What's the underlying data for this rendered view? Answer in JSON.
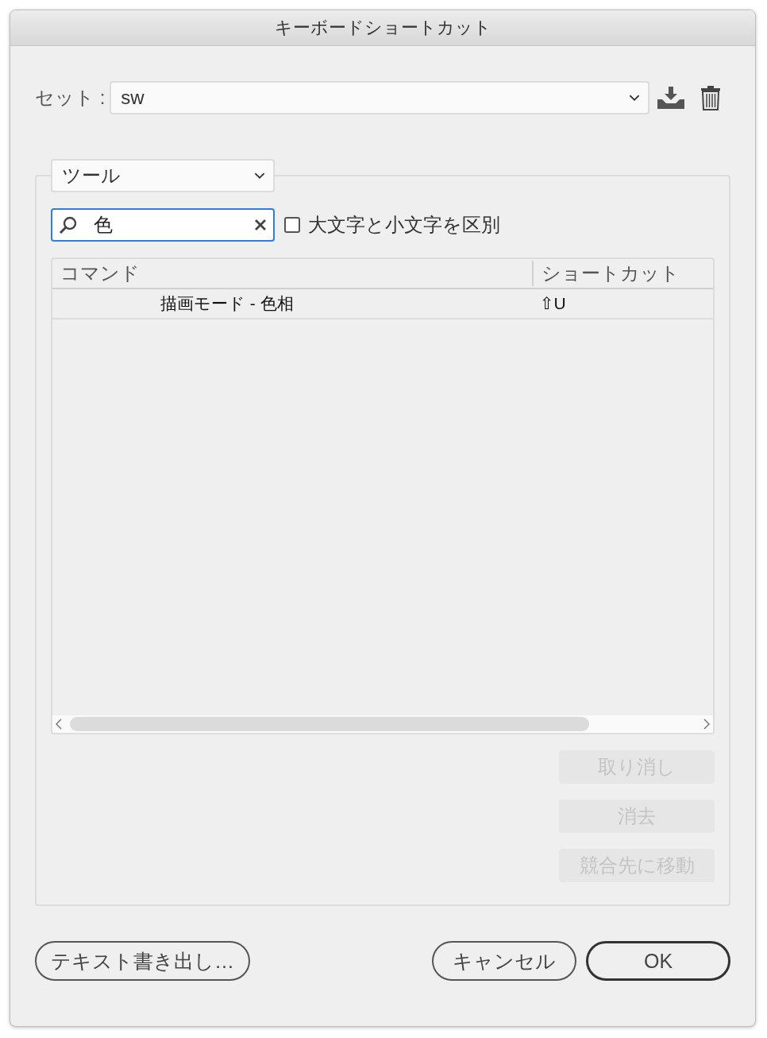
{
  "window": {
    "title": "キーボードショートカット"
  },
  "set": {
    "label": "セット :",
    "value": "sw"
  },
  "category": {
    "value": "ツール"
  },
  "search": {
    "value": "色"
  },
  "case_sensitive": {
    "label": "大文字と小文字を区別",
    "checked": false
  },
  "table": {
    "columns": [
      "コマンド",
      "ショートカット"
    ],
    "rows": [
      {
        "command": "描画モード - 色相",
        "shortcut": "⇧U"
      }
    ]
  },
  "side_buttons": [
    {
      "label": "取り消し",
      "disabled": true
    },
    {
      "label": "消去",
      "disabled": true
    },
    {
      "label": "競合先に移動",
      "disabled": true
    }
  ],
  "buttons": [
    {
      "label": "テキスト書き出し…",
      "kind": "normal"
    },
    {
      "label": "キャンセル",
      "kind": "normal"
    },
    {
      "label": "OK",
      "kind": "default"
    }
  ]
}
